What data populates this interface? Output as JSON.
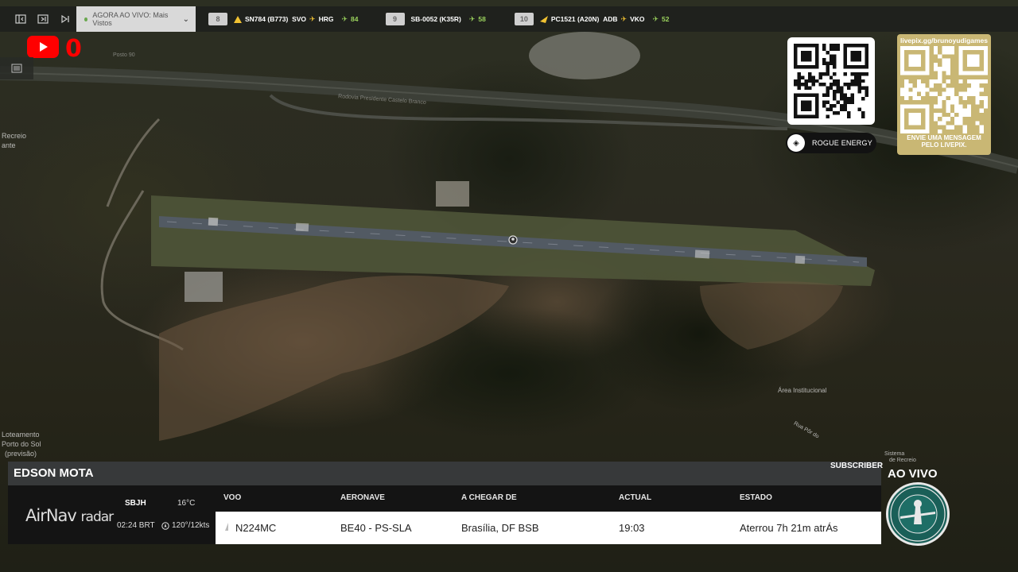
{
  "topbar": {
    "live_label": "AGORA AO VIVO: Mais Vistos",
    "flights": [
      {
        "rank": "8",
        "callsign": "SN784",
        "type": "(B773)",
        "from": "SVO",
        "to": "HRG",
        "count": "84",
        "plane_color": "#f1c232"
      },
      {
        "rank": "9",
        "callsign": "SB-0052",
        "type": "(K35R)",
        "from": "",
        "to": "",
        "count": "58",
        "plane_color": ""
      },
      {
        "rank": "10",
        "callsign": "PC1521",
        "type": "(A20N)",
        "from": "ADB",
        "to": "VKO",
        "count": "52",
        "plane_color": "#f1c232"
      }
    ]
  },
  "youtube": {
    "count": "0"
  },
  "map_labels": {
    "l1": "Recreio",
    "l2": "ante",
    "l3": "Loteamento",
    "l4": "Porto do Sol",
    "l5": "(previsão)",
    "l6": "Área Institucional",
    "l7": "Sistema",
    "l8": "de Recreio",
    "l9": "Rua Pôr do",
    "l10": "Rodovia Presidente Castelo Branco",
    "l11": "Posto 90"
  },
  "promo": {
    "rogue_label": "ROGUE ENERGY",
    "livepix_url": "livepix.gg/brunoyudigames",
    "livepix_msg_1": "ENVIE UMA MENSAGEM",
    "livepix_msg_2": "PELO LIVEPIX."
  },
  "panel": {
    "pilot_name": "EDSON MOTA",
    "subscriber": "SUBSCRIBER",
    "brand_a": "AirNav",
    "brand_b": "radar",
    "airport": "SBJH",
    "local_time": "02:24 BRT",
    "temperature": "16°C",
    "wind": "120°/12kts",
    "headers": {
      "voo": "VOO",
      "aeronave": "AERONAVE",
      "origem": "A CHEGAR DE",
      "actual": "ACTUAL",
      "estado": "ESTADO"
    },
    "row": {
      "voo": "N224MC",
      "aeronave": "BE40 - PS-SLA",
      "origem": "Brasília, DF BSB",
      "actual": "19:03",
      "estado": "Aterrou 7h 21m atrÁs"
    },
    "ao_vivo": "AO VIVO"
  }
}
